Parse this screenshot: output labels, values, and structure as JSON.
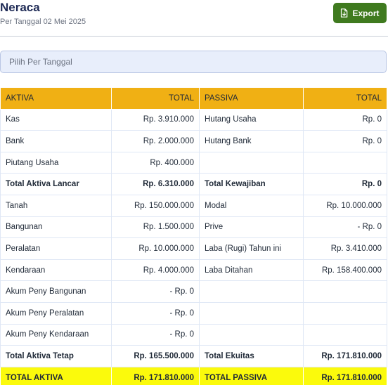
{
  "header": {
    "title": "Neraca",
    "subtitle": "Per Tanggal 02 Mei 2025",
    "export_label": "Export"
  },
  "date_filter": {
    "placeholder": "Pilih Per Tanggal"
  },
  "table": {
    "columns": [
      "AKTIVA",
      "TOTAL",
      "PASSIVA",
      "TOTAL"
    ],
    "rows": [
      {
        "aktiva": "Kas",
        "aktiva_total": "Rp. 3.910.000",
        "passiva": "Hutang Usaha",
        "passiva_total": "Rp. 0"
      },
      {
        "aktiva": "Bank",
        "aktiva_total": "Rp. 2.000.000",
        "passiva": "Hutang Bank",
        "passiva_total": "Rp. 0"
      },
      {
        "aktiva": "Piutang Usaha",
        "aktiva_total": "Rp. 400.000",
        "passiva": "",
        "passiva_total": ""
      },
      {
        "aktiva": "Total Aktiva Lancar",
        "aktiva_total": "Rp. 6.310.000",
        "passiva": "Total Kewajiban",
        "passiva_total": "Rp. 0"
      },
      {
        "aktiva": "Tanah",
        "aktiva_total": "Rp. 150.000.000",
        "passiva": "Modal",
        "passiva_total": "Rp. 10.000.000"
      },
      {
        "aktiva": "Bangunan",
        "aktiva_total": "Rp. 1.500.000",
        "passiva": "Prive",
        "passiva_total": "- Rp. 0"
      },
      {
        "aktiva": "Peralatan",
        "aktiva_total": "Rp. 10.000.000",
        "passiva": "Laba (Rugi) Tahun ini",
        "passiva_total": "Rp. 3.410.000"
      },
      {
        "aktiva": "Kendaraan",
        "aktiva_total": "Rp. 4.000.000",
        "passiva": "Laba Ditahan",
        "passiva_total": "Rp. 158.400.000"
      },
      {
        "aktiva": "Akum Peny Bangunan",
        "aktiva_total": "- Rp. 0",
        "passiva": "",
        "passiva_total": ""
      },
      {
        "aktiva": "Akum Peny Peralatan",
        "aktiva_total": "- Rp. 0",
        "passiva": "",
        "passiva_total": ""
      },
      {
        "aktiva": "Akum Peny Kendaraan",
        "aktiva_total": "- Rp. 0",
        "passiva": "",
        "passiva_total": ""
      },
      {
        "aktiva": "Total Aktiva Tetap",
        "aktiva_total": "Rp. 165.500.000",
        "passiva": "Total Ekuitas",
        "passiva_total": "Rp. 171.810.000"
      },
      {
        "aktiva": "TOTAL AKTIVA",
        "aktiva_total": "Rp. 171.810.000",
        "passiva": "TOTAL PASSIVA",
        "passiva_total": "Rp. 171.810.000"
      }
    ]
  },
  "colors": {
    "header_accent": "#f0b014",
    "grand_total_highlight": "#fbfa0c",
    "export_button": "#3f7a1f",
    "title_text": "#1e2a55"
  },
  "icons": {
    "export": "file-export-icon"
  }
}
